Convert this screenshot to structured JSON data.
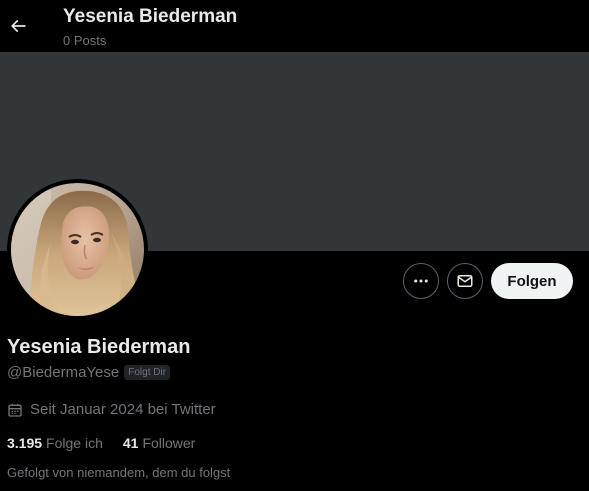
{
  "header": {
    "title": "Yesenia Biederman",
    "post_count": "0 Posts",
    "back_icon": "arrow-left-icon"
  },
  "banner": {
    "color": "#333639"
  },
  "actions": {
    "more_icon": "more-horizontal-icon",
    "message_icon": "envelope-icon",
    "follow_label": "Folgen"
  },
  "profile": {
    "name": "Yesenia Biederman",
    "handle": "@BiedermaYese",
    "follows_you_badge": "Folgt Dir",
    "joined_icon": "calendar-icon",
    "joined": "Seit Januar 2024 bei Twitter",
    "following_count": "3.195",
    "following_label": "Folge ich",
    "followers_count": "41",
    "followers_label": "Follower",
    "followed_by": "Gefolgt von niemandem, dem du folgst"
  },
  "colors": {
    "background": "#000000",
    "text_primary": "#e7e9ea",
    "text_secondary": "#71767b",
    "button_border": "#536471",
    "follow_button_bg": "#eff3f4"
  }
}
